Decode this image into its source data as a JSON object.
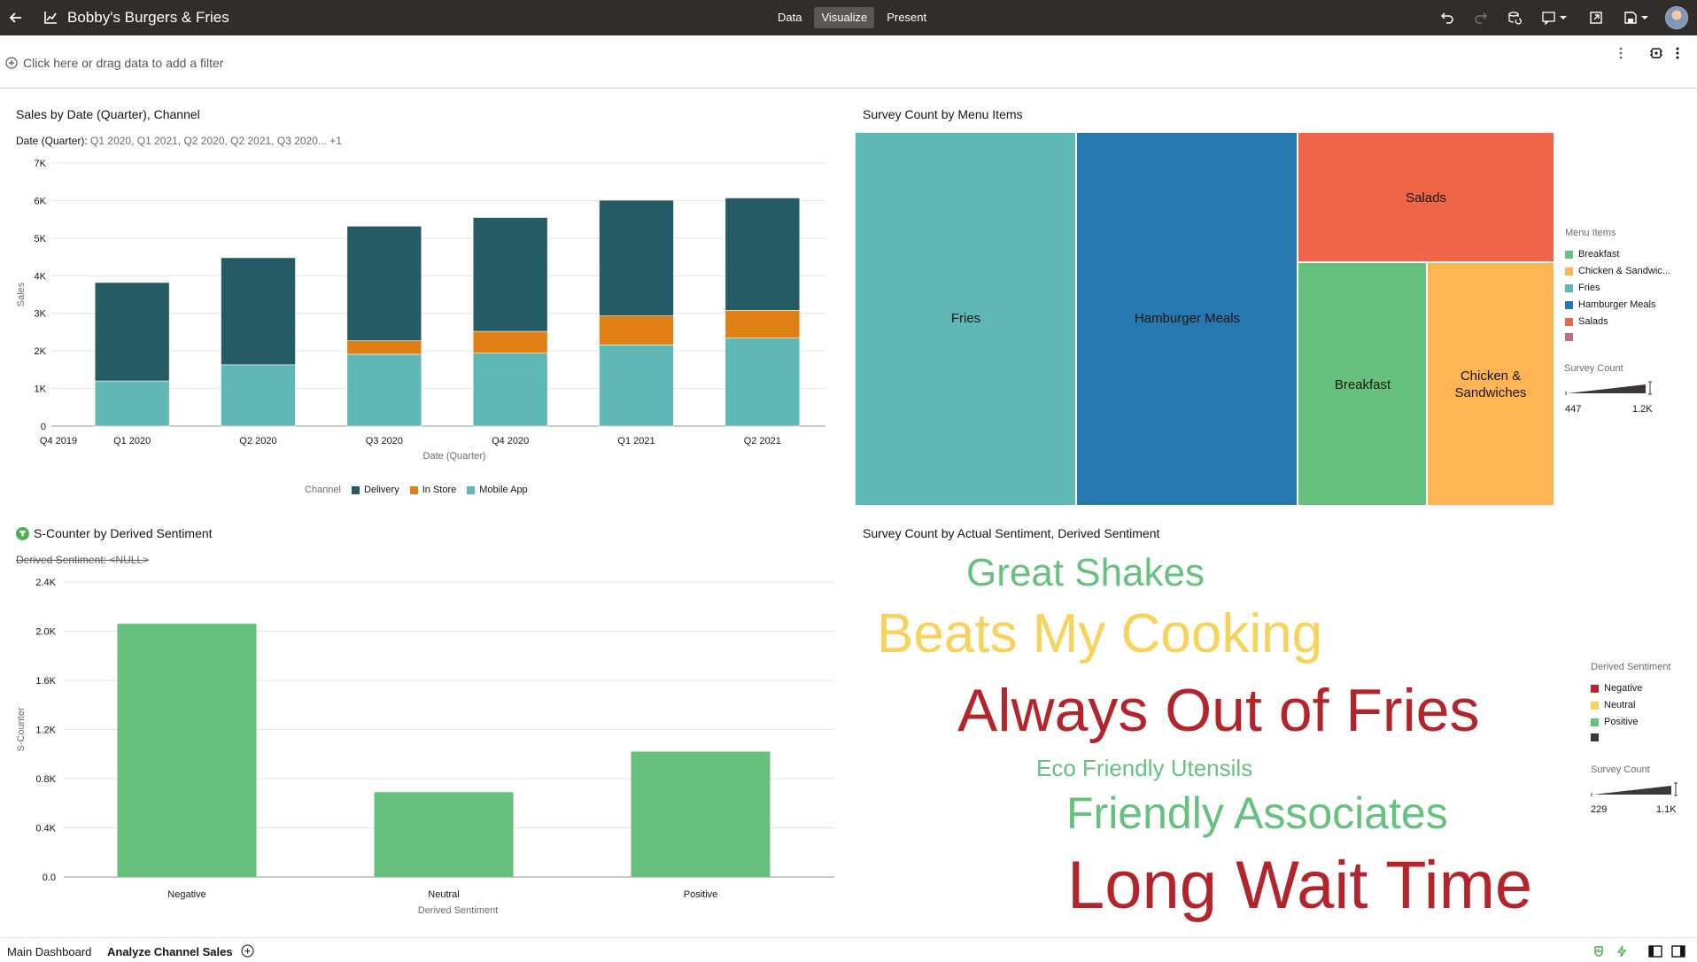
{
  "app": {
    "title": "Bobby's Burgers & Fries",
    "modes": [
      "Data",
      "Visualize",
      "Present"
    ],
    "active_mode": "Visualize"
  },
  "filter_bar": {
    "hint": "Click here or drag data to add a filter"
  },
  "colors": {
    "delivery": "#245b64",
    "in_store": "#e07f14",
    "mobile_app": "#5fb8b6",
    "breakfast": "#66c17f",
    "chicken": "#fdb452",
    "fries": "#5fb8b6",
    "hamburger": "#2878b0",
    "salads": "#ee6548",
    "unknown": "#c06f87",
    "negative": "#b3252b",
    "neutral": "#f8d35b",
    "positive": "#66c17f"
  },
  "panels": {
    "sales": {
      "title": "Sales by Date (Quarter), Channel",
      "filter_label": "Date (Quarter):",
      "filter_values": "Q1 2020, Q1 2021, Q2 2020, Q2 2021, Q3 2020... +1",
      "legend_title": "Channel",
      "legend": [
        "Delivery",
        "In Store",
        "Mobile App"
      ]
    },
    "treemap": {
      "title": "Survey Count by Menu Items",
      "legend_title": "Menu Items",
      "legend": [
        "Breakfast",
        "Chicken & Sandwic...",
        "Fries",
        "Hamburger Meals",
        "Salads",
        ""
      ],
      "size_title": "Survey Count",
      "size_min": "447",
      "size_max": "1.2K",
      "tiles": [
        "Fries",
        "Hamburger Meals",
        "Salads",
        "Breakfast",
        "Chicken &\nSandwiches"
      ]
    },
    "scounter": {
      "title": "S-Counter by Derived Sentiment",
      "filter_label": "Derived Sentiment:",
      "filter_values": "<NULL>"
    },
    "wordcloud": {
      "title": "Survey Count by Actual Sentiment, Derived Sentiment",
      "legend_title": "Derived Sentiment",
      "legend": [
        "Negative",
        "Neutral",
        "Positive",
        ""
      ],
      "size_title": "Survey Count",
      "size_min": "229",
      "size_max": "1.1K",
      "words": [
        {
          "text": "Great Shakes",
          "sentiment": "positive"
        },
        {
          "text": "Beats My Cooking",
          "sentiment": "neutral"
        },
        {
          "text": "Always Out of Fries",
          "sentiment": "negative"
        },
        {
          "text": "Eco Friendly Utensils",
          "sentiment": "positive"
        },
        {
          "text": "Friendly Associates",
          "sentiment": "positive"
        },
        {
          "text": "Long Wait Time",
          "sentiment": "negative"
        }
      ]
    }
  },
  "tabs": [
    "Main Dashboard",
    "Analyze Channel Sales"
  ],
  "active_tab": "Analyze Channel Sales",
  "chart_data": [
    {
      "type": "bar",
      "stacked": true,
      "title": "Sales by Date (Quarter), Channel",
      "xlabel": "Date (Quarter)",
      "ylabel": "Sales",
      "categories": [
        "Q1 2020",
        "Q2 2020",
        "Q3 2020",
        "Q4 2020",
        "Q1 2021",
        "Q2 2021"
      ],
      "extra_tick": "Q4 2019",
      "ylim": [
        0,
        7000
      ],
      "yticks": [
        "0",
        "1K",
        "2K",
        "3K",
        "4K",
        "5K",
        "6K",
        "7K"
      ],
      "series": [
        {
          "name": "Mobile App",
          "values": [
            1200,
            1630,
            1910,
            1940,
            2160,
            2340
          ]
        },
        {
          "name": "In Store",
          "values": [
            0,
            0,
            360,
            580,
            770,
            740
          ]
        },
        {
          "name": "Delivery",
          "values": [
            2620,
            2850,
            3050,
            3030,
            3080,
            2990
          ]
        }
      ],
      "legend_position": "bottom"
    },
    {
      "type": "bar",
      "title": "S-Counter by Derived Sentiment",
      "xlabel": "Derived Sentiment",
      "ylabel": "S-Counter",
      "categories": [
        "Negative",
        "Neutral",
        "Positive"
      ],
      "values": [
        2060,
        690,
        1020
      ],
      "ylim": [
        0,
        2400
      ],
      "yticks": [
        "0.0",
        "0.4K",
        "0.8K",
        "1.2K",
        "1.6K",
        "2.0K",
        "2.4K"
      ]
    }
  ]
}
